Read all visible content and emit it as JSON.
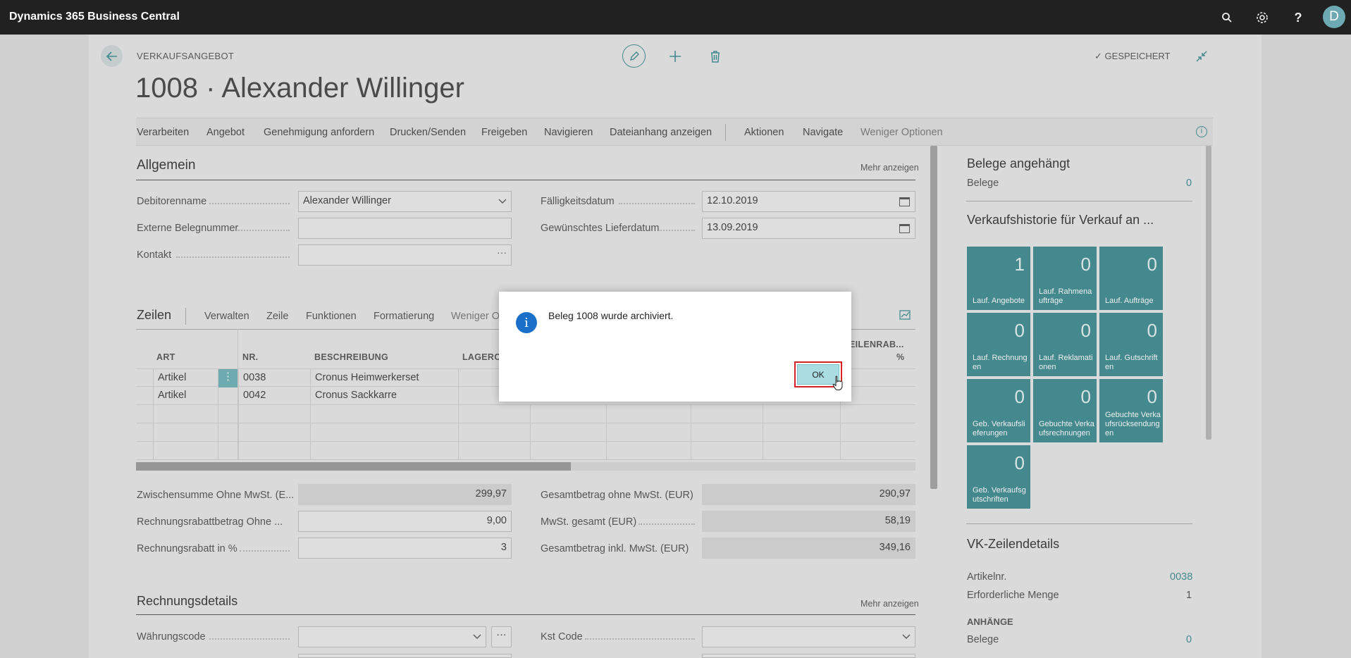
{
  "app": {
    "title": "Dynamics 365 Business Central",
    "avatar_initial": "D"
  },
  "header": {
    "breadcrumb": "VERKAUFSANGEBOT",
    "title": "1008 · Alexander Willinger",
    "saved_label": "GESPEICHERT"
  },
  "actions": [
    "Verarbeiten",
    "Angebot",
    "Genehmigung anfordern",
    "Drucken/Senden",
    "Freigeben",
    "Navigieren",
    "Dateianhang anzeigen",
    "Aktionen",
    "Navigate",
    "Weniger Optionen"
  ],
  "general": {
    "title": "Allgemein",
    "show_more": "Mehr anzeigen",
    "customer_name_label": "Debitorenname",
    "customer_name_value": "Alexander Willinger",
    "external_doc_label": "Externe Belegnummer",
    "external_doc_value": "",
    "contact_label": "Kontakt",
    "contact_value": "",
    "contact_more": "···",
    "due_date_label": "Fälligkeitsdatum",
    "due_date_value": "12.10.2019",
    "req_delivery_label": "Gewünschtes Lieferdatum",
    "req_delivery_value": "13.09.2019"
  },
  "lines": {
    "title": "Zeilen",
    "menu": [
      "Verwalten",
      "Zeile",
      "Funktionen",
      "Formatierung",
      "Weniger O"
    ],
    "col_art": "ART",
    "col_nr": "NR.",
    "col_desc": "BESCHREIBUNG",
    "col_lager": "LAGERO",
    "col_rabatt": "EILENRAB...",
    "col_rabatt_unit": "%",
    "row_menu": "⋮",
    "rows": [
      {
        "art": "Artikel",
        "nr": "0038",
        "desc": "Cronus Heimwerkerset"
      },
      {
        "art": "Artikel",
        "nr": "0042",
        "desc": "Cronus Sackkarre"
      }
    ]
  },
  "totals": {
    "subtotal_label": "Zwischensumme Ohne MwSt. (E...",
    "subtotal_value": "299,97",
    "inv_disc_amount_label": "Rechnungsrabattbetrag Ohne ...",
    "inv_disc_amount_value": "9,00",
    "inv_disc_pct_label": "Rechnungsrabatt in %",
    "inv_disc_pct_value": "3",
    "total_excl_label": "Gesamtbetrag ohne MwSt. (EUR)",
    "total_excl_value": "290,97",
    "vat_label": "MwSt. gesamt (EUR)",
    "vat_value": "58,19",
    "total_incl_label": "Gesamtbetrag inkl. MwSt. (EUR)",
    "total_incl_value": "349,16"
  },
  "invoice": {
    "title": "Rechnungsdetails",
    "show_more": "Mehr anzeigen",
    "currency_label": "Währungscode",
    "currency_more": "···",
    "cost_label": "Kst Code"
  },
  "factbox": {
    "attached_title": "Belege angehängt",
    "attached_label": "Belege",
    "attached_value": "0",
    "history_title": "Verkaufshistorie für Verkauf an ...",
    "tiles": [
      {
        "n": "1",
        "l": "Lauf. Angebote"
      },
      {
        "n": "0",
        "l": "Lauf. Rahmenaufträge"
      },
      {
        "n": "0",
        "l": "Lauf. Aufträge"
      },
      {
        "n": "0",
        "l": "Lauf. Rechnungen"
      },
      {
        "n": "0",
        "l": "Lauf. Reklamationen"
      },
      {
        "n": "0",
        "l": "Lauf. Gutschriften"
      },
      {
        "n": "0",
        "l": "Geb. Verkaufslieferungen"
      },
      {
        "n": "0",
        "l": "Gebuchte Verkaufsrechnungen"
      },
      {
        "n": "0",
        "l": "Gebuchte Verkaufsrücksendungen"
      },
      {
        "n": "0",
        "l": "Geb. Verkaufsgutschriften"
      }
    ],
    "line_details_title": "VK-Zeilendetails",
    "item_no_label": "Artikelnr.",
    "item_no_value": "0038",
    "req_qty_label": "Erforderliche Menge",
    "req_qty_value": "1",
    "attachments_header": "ANHÄNGE",
    "attachments_label": "Belege",
    "attachments_value": "0"
  },
  "dialog": {
    "message": "Beleg 1008 wurde archiviert.",
    "ok_label": "OK",
    "info_glyph": "i"
  },
  "icons": [
    "search-icon",
    "gear-icon",
    "help-icon",
    "back-icon",
    "edit-icon",
    "add-icon",
    "delete-icon",
    "collapse-icon",
    "info-icon",
    "calendar-icon",
    "chevron-down-icon",
    "chart-icon"
  ],
  "colors": {
    "accent": "#3c8b91",
    "topbar": "#212121",
    "dialog_info": "#1a6fc9",
    "ok_highlight": "#d6232a"
  }
}
